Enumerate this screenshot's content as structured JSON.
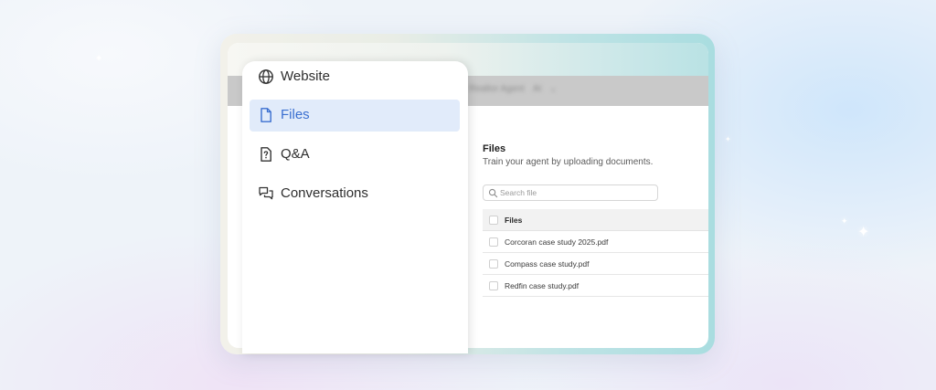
{
  "colors": {
    "accent": "#3a6fd0",
    "active_bg": "#e1ebfa",
    "header_bar": "#c9c9c9"
  },
  "sidebar": {
    "items": [
      {
        "label": "Website",
        "icon": "globe-icon",
        "active": false
      },
      {
        "label": "Files",
        "icon": "file-icon",
        "active": true
      },
      {
        "label": "Q&A",
        "icon": "question-file-icon",
        "active": false
      },
      {
        "label": "Conversations",
        "icon": "chat-bubbles-icon",
        "active": false
      }
    ]
  },
  "header": {
    "agent_name": "Realtor Agent",
    "agent_badge": "AI"
  },
  "main": {
    "title": "Files",
    "subtitle": "Train your agent by uploading documents.",
    "search": {
      "placeholder": "Search file"
    },
    "table": {
      "header": "Files",
      "rows": [
        "Corcoran case study 2025.pdf",
        "Compass case study.pdf",
        "Redfin case study.pdf"
      ]
    }
  }
}
